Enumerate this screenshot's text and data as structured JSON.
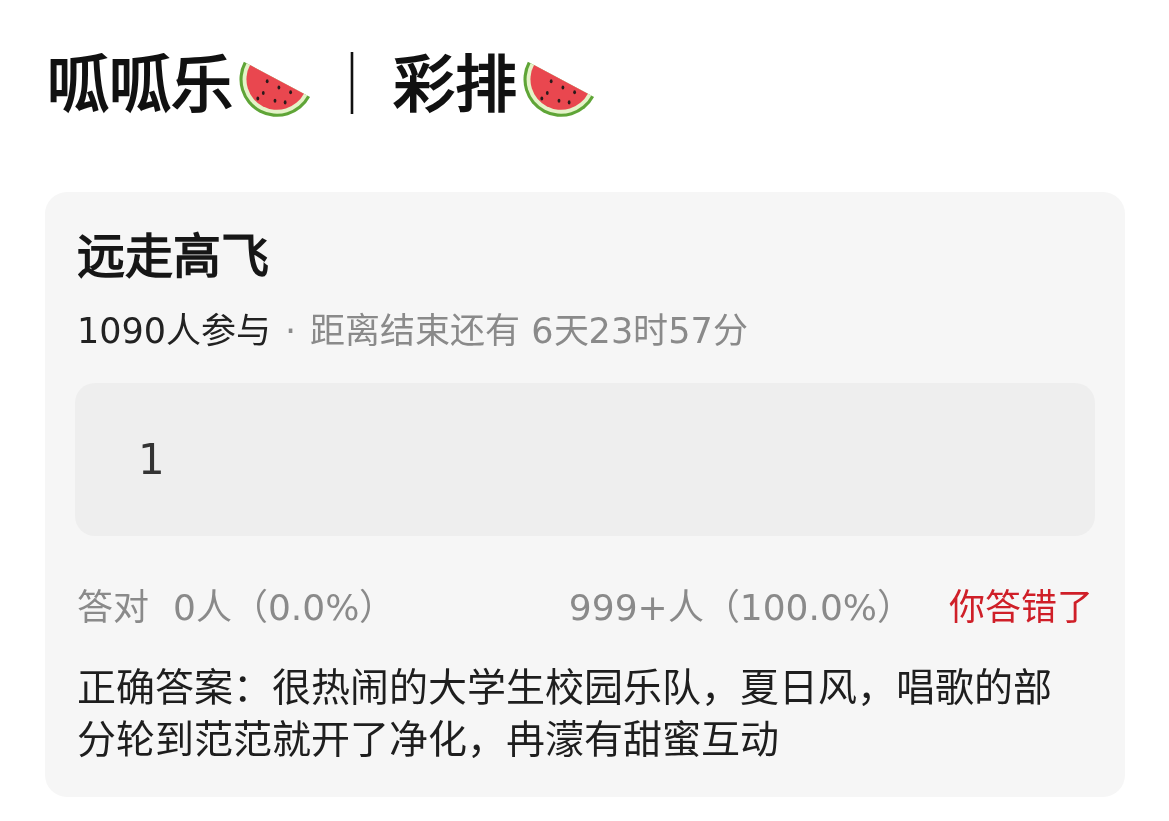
{
  "header": {
    "title": "呱呱乐",
    "separator": "｜",
    "subtitle": "彩排"
  },
  "card": {
    "title": "远走高飞",
    "participants": "1090人参与",
    "dot": "·",
    "countdown": "距离结束还有 6天23时57分",
    "answer": {
      "value": "1"
    },
    "stats": {
      "correct_label": "答对",
      "correct_count": "0人（0.0%）",
      "wrong_count": "999+人（100.0%）"
    },
    "verdict": {
      "text": "你答错了",
      "correct": false
    },
    "correct_answer": "正确答案：很热闹的大学生校园乐队，夏日风，唱歌的部分轮到范范就开了净化，冉濛有甜蜜互动"
  }
}
